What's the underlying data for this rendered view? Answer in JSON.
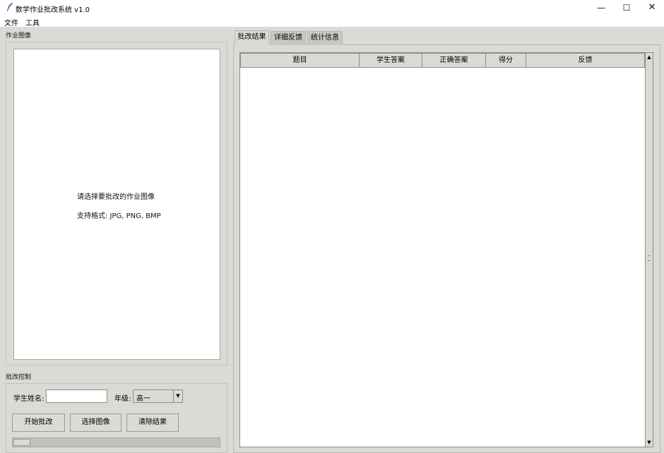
{
  "window": {
    "title": "数学作业批改系统 v1.0",
    "minimize_glyph": "—",
    "maximize_glyph": "☐",
    "close_glyph": "✕"
  },
  "menu": {
    "file": "文件",
    "tools": "工具"
  },
  "image_panel": {
    "label": "作业图像",
    "hint_line1": "请选择要批改的作业图像",
    "hint_line2": "支持格式: JPG, PNG, BMP"
  },
  "control_panel": {
    "label": "批改控制",
    "student_name_label": "学生姓名:",
    "student_name_value": "",
    "grade_label": "年级:",
    "grade_value": "高一",
    "start_button": "开始批改",
    "select_image_button": "选择图像",
    "clear_button": "清除结果",
    "progress": 0
  },
  "tabs": [
    {
      "label": "批改结果",
      "active": true
    },
    {
      "label": "详细反馈",
      "active": false
    },
    {
      "label": "统计信息",
      "active": false
    }
  ],
  "results_table": {
    "columns": [
      "题目",
      "学生答案",
      "正确答案",
      "得分",
      "反馈"
    ],
    "rows": []
  },
  "colors": {
    "window_bg": "#dcdad5",
    "titlebar_bg": "#ffffff",
    "canvas_bg": "#ffffff"
  }
}
